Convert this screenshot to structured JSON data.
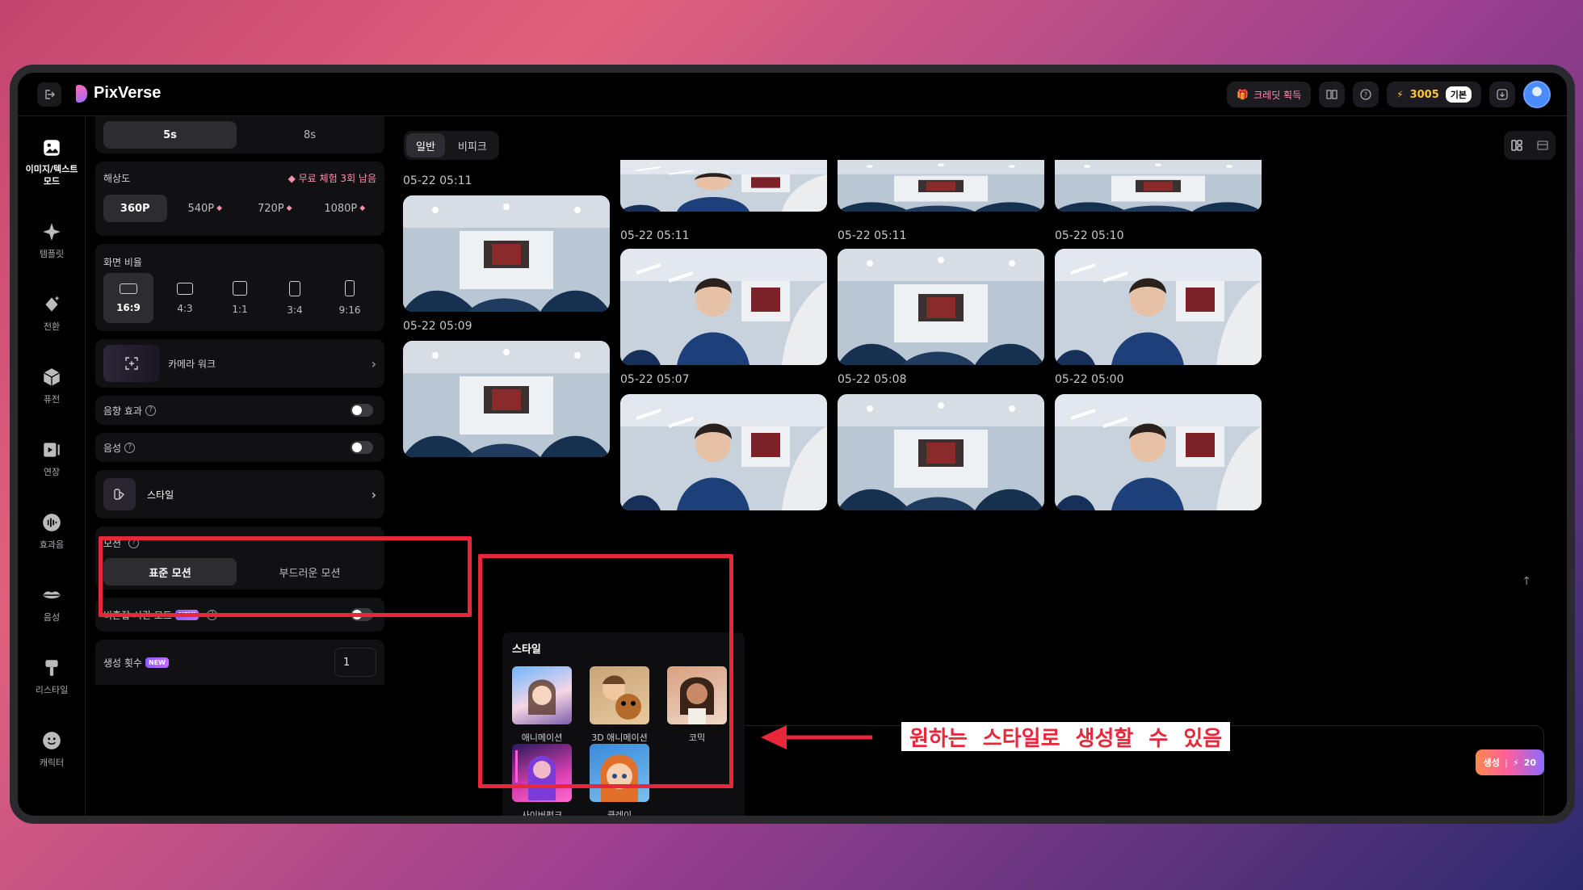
{
  "app": {
    "name": "PixVerse"
  },
  "topbar": {
    "credit_pill": "크레딧 획득",
    "credit_count": "3005",
    "tier": "기본"
  },
  "sidebar": {
    "items": [
      {
        "label": "이미지/텍스트 모드",
        "icon": "image-icon"
      },
      {
        "label": "템플릿",
        "icon": "sparkle-icon"
      },
      {
        "label": "전환",
        "icon": "transition-icon"
      },
      {
        "label": "퓨전",
        "icon": "cube-icon"
      },
      {
        "label": "연장",
        "icon": "extend-icon"
      },
      {
        "label": "효과음",
        "icon": "sound-icon"
      },
      {
        "label": "음성",
        "icon": "lips-icon"
      },
      {
        "label": "리스타일",
        "icon": "brush-icon"
      },
      {
        "label": "캐릭터",
        "icon": "face-icon"
      }
    ]
  },
  "panel": {
    "duration": {
      "options": [
        "5s",
        "8s"
      ],
      "selected": "5s"
    },
    "resolution": {
      "title": "해상도",
      "trial": "무료 체험 3회 남음",
      "options": [
        "360P",
        "540P",
        "720P",
        "1080P"
      ],
      "selected": "360P"
    },
    "aspect": {
      "title": "화면 비율",
      "options": [
        "16:9",
        "4:3",
        "1:1",
        "3:4",
        "9:16"
      ],
      "selected": "16:9"
    },
    "camera_work": "카메라 워크",
    "sound_effect": "음향 효과",
    "voice": "음성",
    "style": "스타일",
    "motion": {
      "title": "모션",
      "options": [
        "표준 모션",
        "부드러운 모션"
      ],
      "selected": "표준 모션"
    },
    "off_peak": "비혼잡 시간 모드",
    "new_badge": "NEW",
    "gen_count": {
      "label": "생성 횟수",
      "value": "1"
    }
  },
  "gallery": {
    "tabs": [
      "일반",
      "비피크"
    ],
    "selected_tab": "일반",
    "timestamps": {
      "col1": [
        "05-22 05:11",
        "05-22 05:09"
      ],
      "row1": [
        "05-22 05:11",
        "05-22 05:11",
        "05-22 05:10"
      ],
      "row2": [
        "05-22 05:07",
        "05-22 05:08",
        "05-22 05:00"
      ]
    }
  },
  "styles_popup": {
    "title": "스타일",
    "items": [
      "애니메이션",
      "3D 애니메이션",
      "코믹",
      "사이버펑크",
      "클레이"
    ]
  },
  "generate": {
    "label": "생성",
    "cost": "20"
  },
  "annotation": "원하는 스타일로 생성할 수 있음",
  "colors": {
    "accent": "#e8283a",
    "credit": "#ffc634",
    "pink": "#ff8fb1"
  }
}
